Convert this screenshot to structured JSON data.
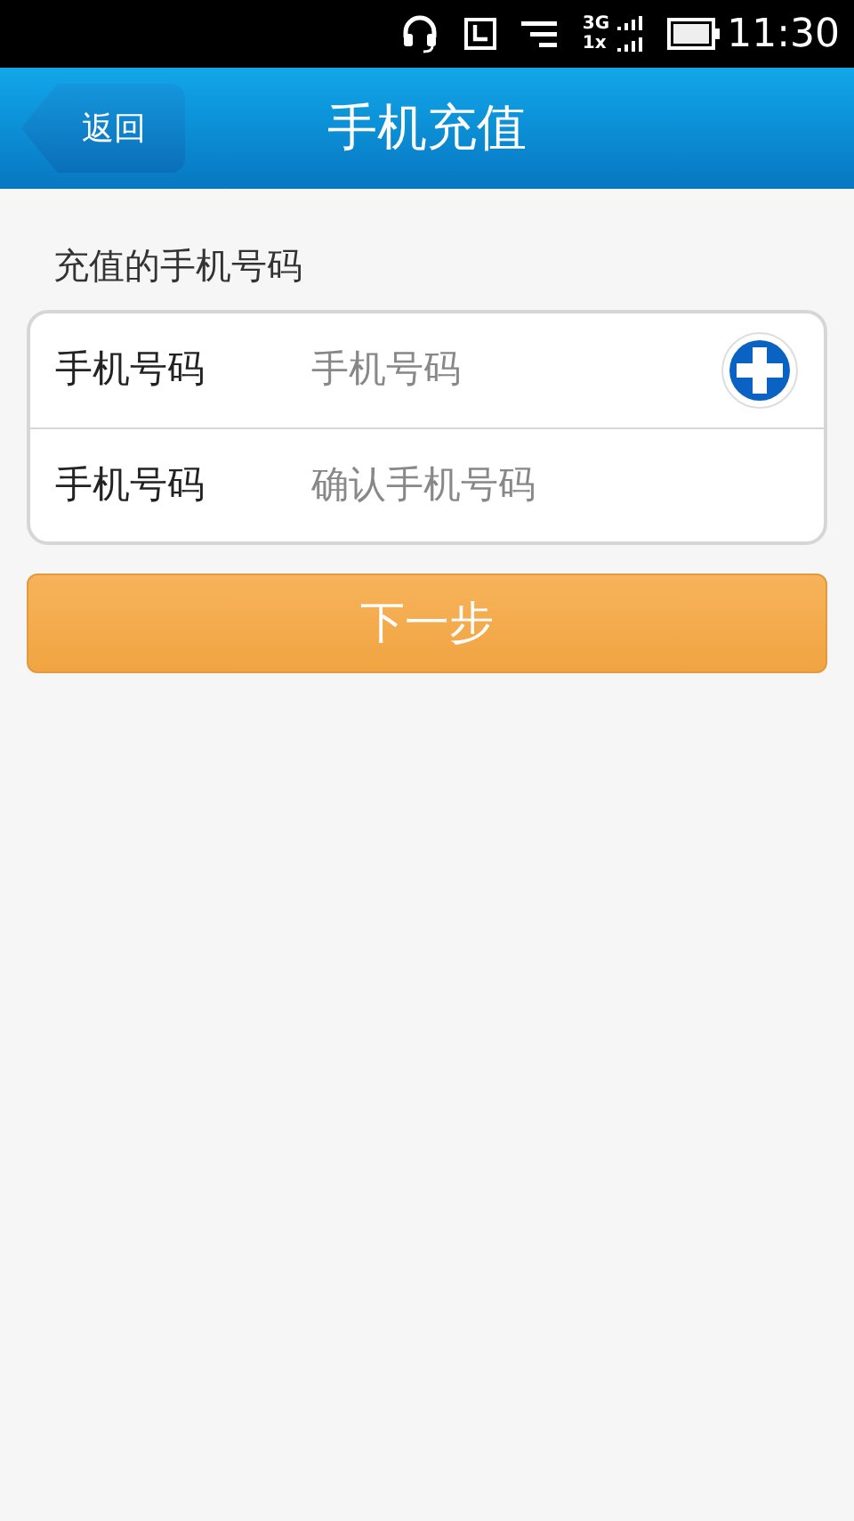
{
  "status_bar": {
    "network_top": "3G",
    "network_bottom": "1x",
    "time": "11:30"
  },
  "header": {
    "back_button": "返回",
    "title": "手机充值"
  },
  "section_label": "充值的手机号码",
  "fields": [
    {
      "label": "手机号码",
      "placeholder": "手机号码",
      "contact_button": true
    },
    {
      "label": "手机号码",
      "placeholder": "确认手机号码",
      "contact_button": false
    }
  ],
  "next_button": "下一步"
}
